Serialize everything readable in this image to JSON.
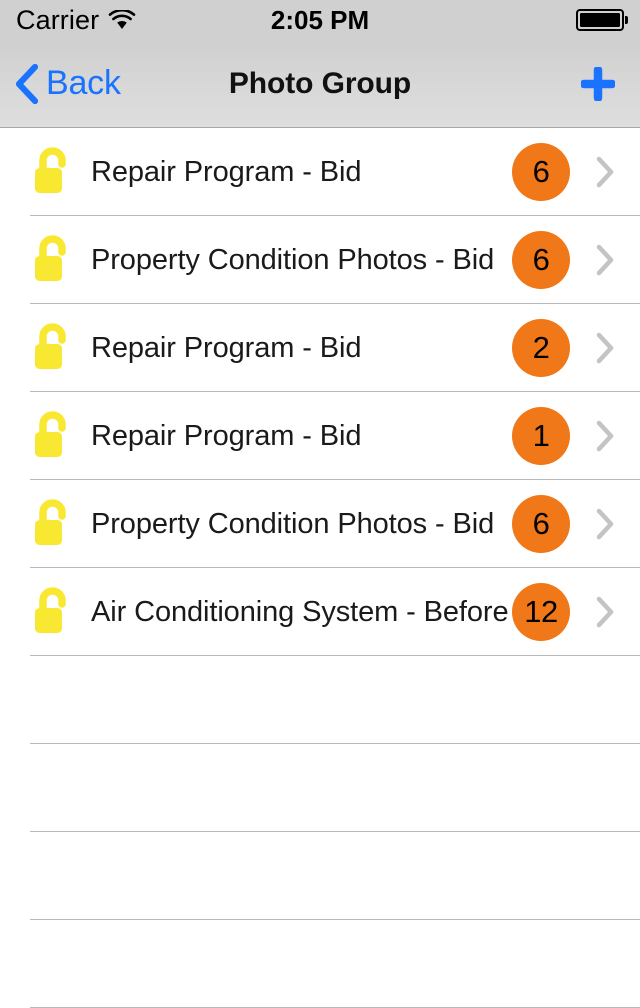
{
  "status_bar": {
    "carrier": "Carrier",
    "wifi_icon": "wifi-icon",
    "time": "2:05 PM",
    "battery_icon": "battery-full-icon"
  },
  "nav_bar": {
    "back_label": "Back",
    "back_icon": "chevron-left-icon",
    "title": "Photo Group",
    "add_icon": "plus-icon"
  },
  "colors": {
    "accent_blue": "#1a73ff",
    "badge_orange": "#f07818",
    "lock_yellow": "#f8e832",
    "chevron_gray": "#c4c4c4",
    "separator": "#b8b8b8",
    "nav_background": "#d8d8d8",
    "status_background": "#d0d0d0"
  },
  "list": {
    "icon_name": "lock-open-icon",
    "disclosure_icon": "chevron-right-icon",
    "rows": [
      {
        "title": "Repair Program - Bid",
        "count": "6"
      },
      {
        "title": "Property Condition Photos - Bid",
        "count": "6"
      },
      {
        "title": "Repair Program - Bid",
        "count": "2"
      },
      {
        "title": "Repair Program - Bid",
        "count": "1"
      },
      {
        "title": "Property Condition Photos - Bid",
        "count": "6"
      },
      {
        "title": "Air Conditioning System - Before",
        "count": "12"
      }
    ],
    "empty_row_count": 4
  }
}
